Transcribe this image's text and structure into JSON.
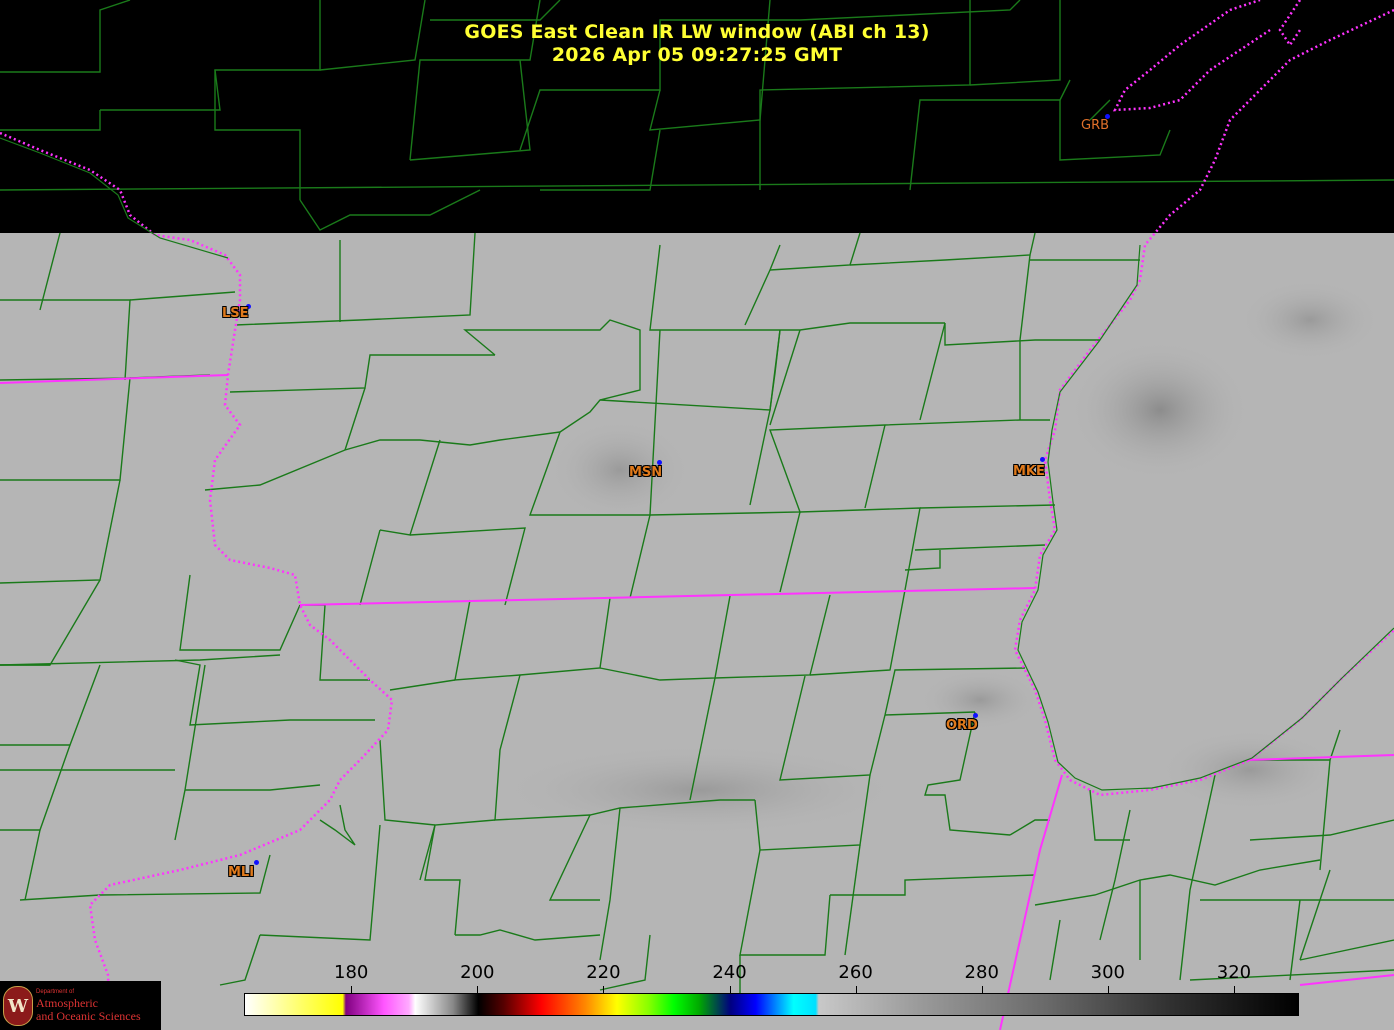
{
  "title": {
    "line1": "GOES East Clean IR LW window (ABI ch 13)",
    "line2": "2026 Apr 05  09:27:25 GMT"
  },
  "stations": [
    {
      "id": "lse",
      "label": "LSE"
    },
    {
      "id": "msn",
      "label": "MSN"
    },
    {
      "id": "mke",
      "label": "MKE"
    },
    {
      "id": "ord",
      "label": "ORD"
    },
    {
      "id": "mli",
      "label": "MLI"
    },
    {
      "id": "grb",
      "label": "GRB"
    }
  ],
  "colorbar": {
    "ticks": [
      "180",
      "200",
      "220",
      "240",
      "260",
      "280",
      "300",
      "320"
    ],
    "range": [
      163,
      330
    ]
  },
  "logo": {
    "seal_letter": "W",
    "dept": "Department of",
    "line1": "Atmospheric",
    "line2": "and Oceanic Sciences"
  },
  "colors": {
    "title": "#ffff33",
    "county_lines": "#1a7a1a",
    "state_lines": "#ff33ff",
    "station_label": "#e07a1c",
    "station_dot": "#1010ff",
    "imagery_gray": "#b4b4b4",
    "no_data": "#000000"
  }
}
